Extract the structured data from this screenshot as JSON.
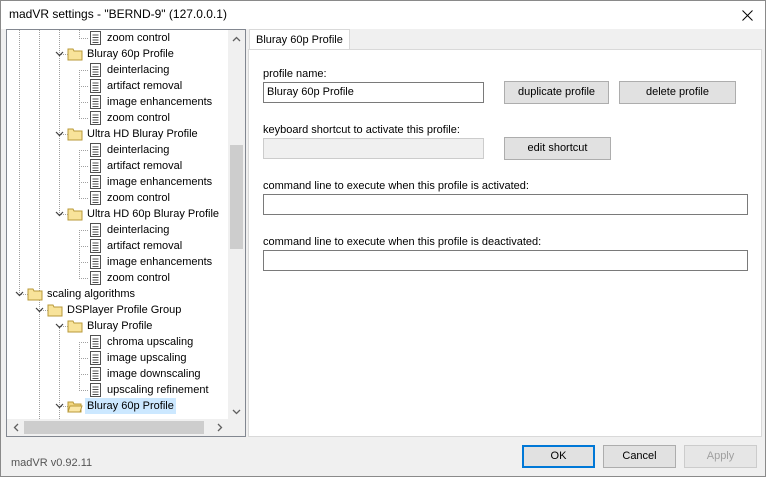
{
  "window": {
    "title": "madVR settings - \"BERND-9\" (127.0.0.1)"
  },
  "tree": {
    "items": [
      {
        "label": "zoom control",
        "type": "page"
      },
      {
        "label": "Bluray 60p Profile",
        "type": "folder"
      },
      {
        "label": "deinterlacing",
        "type": "page"
      },
      {
        "label": "artifact removal",
        "type": "page"
      },
      {
        "label": "image enhancements",
        "type": "page"
      },
      {
        "label": "zoom control",
        "type": "page"
      },
      {
        "label": "Ultra HD Bluray Profile",
        "type": "folder"
      },
      {
        "label": "deinterlacing",
        "type": "page"
      },
      {
        "label": "artifact removal",
        "type": "page"
      },
      {
        "label": "image enhancements",
        "type": "page"
      },
      {
        "label": "zoom control",
        "type": "page"
      },
      {
        "label": "Ultra HD 60p Bluray Profile",
        "type": "folder"
      },
      {
        "label": "deinterlacing",
        "type": "page"
      },
      {
        "label": "artifact removal",
        "type": "page"
      },
      {
        "label": "image enhancements",
        "type": "page"
      },
      {
        "label": "zoom control",
        "type": "page"
      },
      {
        "label": "scaling algorithms",
        "type": "folder"
      },
      {
        "label": "DSPlayer Profile Group",
        "type": "folder"
      },
      {
        "label": "Bluray Profile",
        "type": "folder"
      },
      {
        "label": "chroma upscaling",
        "type": "page"
      },
      {
        "label": "image upscaling",
        "type": "page"
      },
      {
        "label": "image downscaling",
        "type": "page"
      },
      {
        "label": "upscaling refinement",
        "type": "page"
      },
      {
        "label": "Bluray 60p Profile",
        "type": "folder",
        "selected": true
      }
    ]
  },
  "tab": {
    "label": "Bluray 60p Profile"
  },
  "form": {
    "profile_name_label": "profile name:",
    "profile_name_value": "Bluray 60p Profile",
    "duplicate_label": "duplicate profile",
    "delete_label": "delete profile",
    "shortcut_label": "keyboard shortcut to activate this profile:",
    "shortcut_value": "",
    "edit_shortcut_label": "edit shortcut",
    "cmd_activate_label": "command line to execute when this profile is activated:",
    "cmd_activate_value": "",
    "cmd_deactivate_label": "command line to execute when this profile is deactivated:",
    "cmd_deactivate_value": ""
  },
  "footer": {
    "version": "madVR v0.92.11",
    "ok_label": "OK",
    "cancel_label": "Cancel",
    "apply_label": "Apply"
  }
}
